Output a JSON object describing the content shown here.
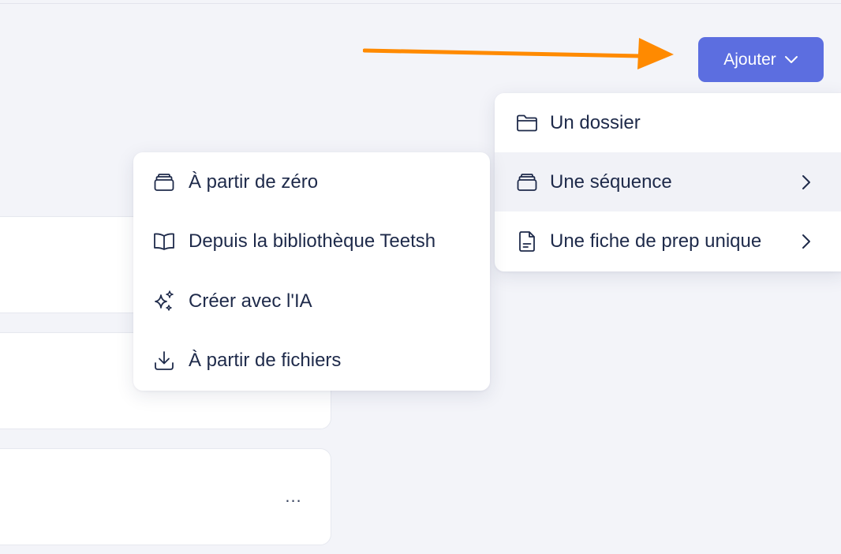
{
  "add_button": {
    "label": "Ajouter",
    "icon": "chevron-down-icon",
    "color": "#5c6ee0"
  },
  "arrow": {
    "color": "#ff8a00"
  },
  "add_menu": {
    "items": [
      {
        "label": "Un dossier",
        "icon": "folder-icon",
        "has_submenu": false
      },
      {
        "label": "Une séquence",
        "icon": "stack-icon",
        "has_submenu": true,
        "active": true
      },
      {
        "label": "Une fiche de prep unique",
        "icon": "document-icon",
        "has_submenu": true
      }
    ]
  },
  "sequence_submenu": {
    "items": [
      {
        "label": "À partir de zéro",
        "icon": "stack-icon"
      },
      {
        "label": "Depuis la bibliothèque Teetsh",
        "icon": "book-icon"
      },
      {
        "label": "Créer avec l'IA",
        "icon": "sparkles-icon"
      },
      {
        "label": "À partir de fichiers",
        "icon": "download-icon"
      }
    ]
  },
  "list": {
    "more_label": "..."
  }
}
